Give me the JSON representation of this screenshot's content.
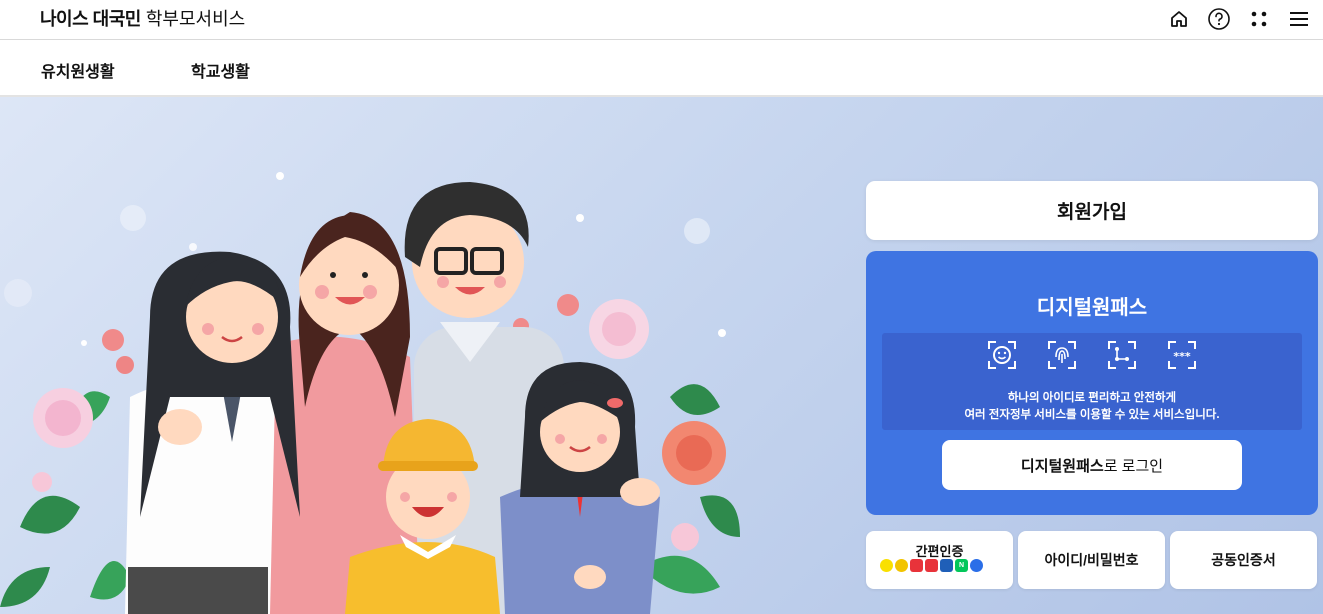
{
  "header": {
    "brand_bold": "나이스 대국민",
    "brand_sub": "학부모서비스",
    "icons": [
      "home-icon",
      "help-icon",
      "apps-icon",
      "menu-icon"
    ]
  },
  "nav": {
    "items": [
      {
        "label": "유치원생활"
      },
      {
        "label": "학교생활"
      }
    ]
  },
  "panel": {
    "signup_label": "회원가입",
    "digital_onepass": {
      "title": "디지털원패스",
      "desc_line1": "하나의 아이디로 편리하고 안전하게",
      "desc_line2": "여러 전자정부 서비스를 이용할 수 있는 서비스입니다.",
      "login_bold": "디지털원패스",
      "login_rest": "로 로그인",
      "icons": [
        "face-id-icon",
        "fingerprint-icon",
        "pattern-icon",
        "pin-icon"
      ],
      "pin_text": "***"
    },
    "auth": {
      "simple_label": "간편인증",
      "simple_logos": [
        {
          "name": "kakao-logo",
          "color": "#f9e000",
          "text": ""
        },
        {
          "name": "pass-logo",
          "color": "#f2c400",
          "text": ""
        },
        {
          "name": "payco-logo",
          "color": "#e8333a",
          "text": ""
        },
        {
          "name": "samsung-pass-logo",
          "color": "#e8333a",
          "text": ""
        },
        {
          "name": "kb-logo",
          "color": "#1f5fb8",
          "text": ""
        },
        {
          "name": "naver-logo",
          "color": "#03c75a",
          "text": "N"
        },
        {
          "name": "toss-logo",
          "color": "#2a6ee8",
          "text": ""
        }
      ],
      "id_pw_label": "아이디/비밀번호",
      "cert_label": "공동인증서"
    }
  },
  "colors": {
    "onepass_blue": "#3f74e2",
    "onepass_box": "#3a63cf",
    "hero_bg": "#c7d6ef"
  }
}
